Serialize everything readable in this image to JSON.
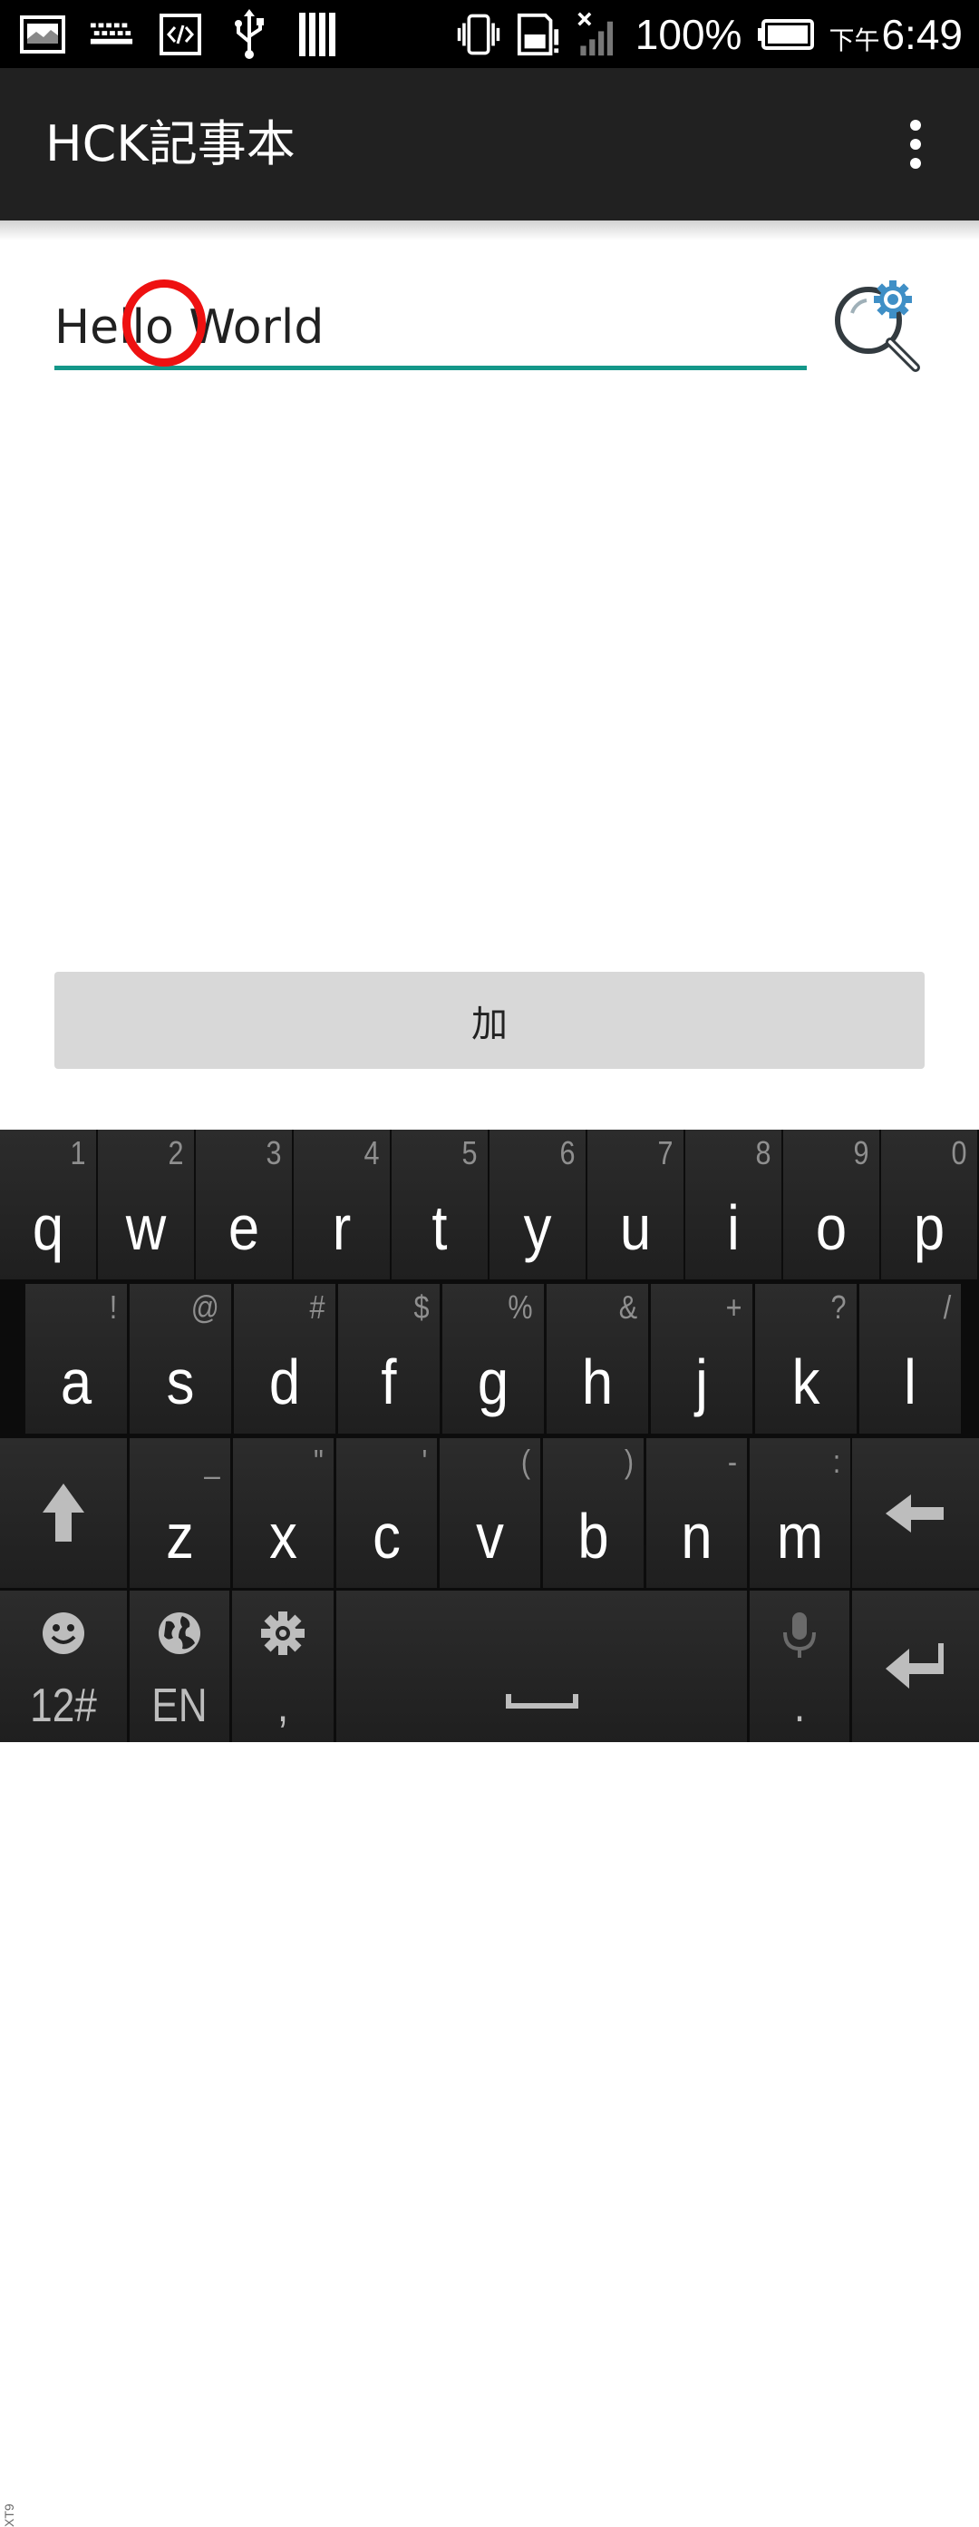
{
  "status_bar": {
    "battery": "100%",
    "time_prefix": "下午",
    "time": "6:49"
  },
  "app_bar": {
    "title": "HCK記事本"
  },
  "note_input": {
    "value": "Hello World"
  },
  "add_button": {
    "label": "加"
  },
  "keyboard": {
    "row1": [
      {
        "main": "q",
        "sub": "1"
      },
      {
        "main": "w",
        "sub": "2"
      },
      {
        "main": "e",
        "sub": "3"
      },
      {
        "main": "r",
        "sub": "4"
      },
      {
        "main": "t",
        "sub": "5"
      },
      {
        "main": "y",
        "sub": "6"
      },
      {
        "main": "u",
        "sub": "7"
      },
      {
        "main": "i",
        "sub": "8"
      },
      {
        "main": "o",
        "sub": "9"
      },
      {
        "main": "p",
        "sub": "0"
      }
    ],
    "row2": [
      {
        "main": "a",
        "sub": "!"
      },
      {
        "main": "s",
        "sub": "@"
      },
      {
        "main": "d",
        "sub": "#"
      },
      {
        "main": "f",
        "sub": "$"
      },
      {
        "main": "g",
        "sub": "%"
      },
      {
        "main": "h",
        "sub": "&"
      },
      {
        "main": "j",
        "sub": "+"
      },
      {
        "main": "k",
        "sub": "?"
      },
      {
        "main": "l",
        "sub": "/"
      }
    ],
    "row3": [
      {
        "main": "z",
        "sub": "_"
      },
      {
        "main": "x",
        "sub": "\""
      },
      {
        "main": "c",
        "sub": "'"
      },
      {
        "main": "v",
        "sub": "("
      },
      {
        "main": "b",
        "sub": ")"
      },
      {
        "main": "n",
        "sub": "-"
      },
      {
        "main": "m",
        "sub": ":"
      }
    ],
    "side_label": "XT9",
    "numbers_key": "12#",
    "language_key": "EN",
    "comma_key": ",",
    "period_key": "."
  },
  "colors": {
    "accent": "#149789",
    "app_bar": "#212121",
    "tap_marker": "#ee1111"
  }
}
